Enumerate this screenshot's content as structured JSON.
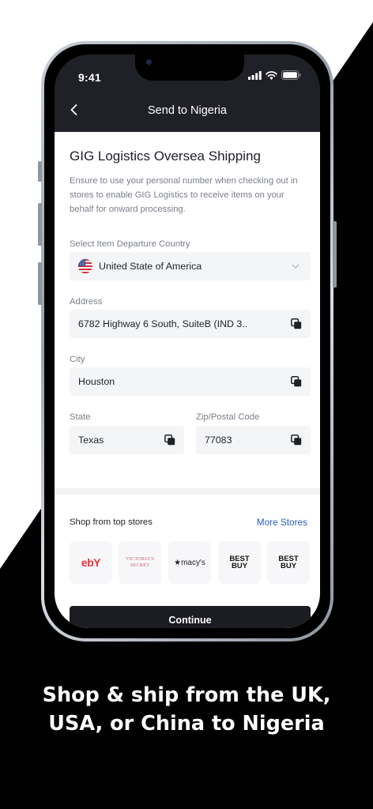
{
  "status_bar": {
    "time": "9:41",
    "icons": [
      "signal-icon",
      "wifi-icon",
      "battery-icon"
    ]
  },
  "nav": {
    "title": "Send to Nigeria",
    "back_icon": "chevron-left-icon"
  },
  "heading": "GIG Logistics Oversea Shipping",
  "description": "Ensure to use your personal number when checking out in stores to enable GIG Logistics to receive items on your behalf for onward processing.",
  "country": {
    "label": "Select Item Departure Country",
    "value": "United State of America",
    "flag_icon": "us-flag-icon"
  },
  "address": {
    "label": "Address",
    "value": "6782 Highway 6 South, SuiteB (IND 3.."
  },
  "city": {
    "label": "City",
    "value": "Houston"
  },
  "state": {
    "label": "State",
    "value": "Texas"
  },
  "zip": {
    "label": "Zip/Postal Code",
    "value": "77083"
  },
  "stores": {
    "label": "Shop from top stores",
    "more_label": "More Stores",
    "items": [
      {
        "name": "eBay",
        "logo_text": "ebY"
      },
      {
        "name": "Victoria's Secret",
        "logo_text": "VICTORIA'S SECRET"
      },
      {
        "name": "Macy's",
        "logo_text": "★macy's"
      },
      {
        "name": "Best Buy",
        "logo_text": "BEST BUY"
      },
      {
        "name": "Best Buy",
        "logo_text": "BEST BUY"
      }
    ]
  },
  "continue_label": "Continue",
  "promo": {
    "line1": "Shop & ship from the UK,",
    "line2": "USA, or China to Nigeria"
  },
  "colors": {
    "background_dark": "#000000",
    "nav_bg": "#202128",
    "accent_link": "#2a5dbe",
    "button_bg": "#1c1d23",
    "field_bg": "#f4f5f7"
  }
}
